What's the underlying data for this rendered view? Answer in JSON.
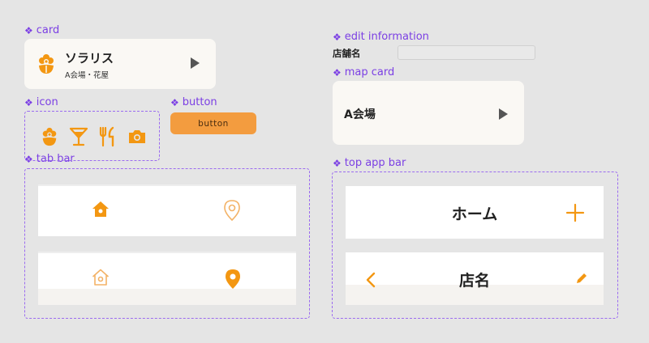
{
  "sections": {
    "card": "card",
    "edit_information": "edit information",
    "map_card": "map card",
    "icon": "icon",
    "button": "button",
    "tab_bar": "tab bar",
    "top_app_bar": "top app bar"
  },
  "card": {
    "title": "ソラリス",
    "subtitle": "A会場・花屋",
    "icon": "flower-icon",
    "action_icon": "play-icon"
  },
  "edit_information": {
    "label": "店舗名",
    "value": ""
  },
  "map_card": {
    "title": "A会場",
    "action_icon": "play-icon"
  },
  "icons": [
    "flower-icon",
    "cocktail-icon",
    "fork-knife-icon",
    "camera-icon"
  ],
  "button": {
    "label": "button"
  },
  "tab_bars": [
    {
      "selected": "home",
      "items": [
        "home-icon",
        "location-pin-icon"
      ]
    },
    {
      "selected": "map",
      "items": [
        "home-icon",
        "location-pin-icon"
      ]
    }
  ],
  "top_app_bars": [
    {
      "title": "ホーム",
      "right_icon": "plus-icon"
    },
    {
      "title": "店名",
      "left_icon": "back-chevron-icon",
      "right_icon": "pencil-icon"
    }
  ],
  "colors": {
    "accent": "#f39712",
    "label_purple": "#7b3fe4",
    "card_bg": "#faf8f4",
    "button_bg": "#f39c3f",
    "page_bg": "#e5e5e5"
  }
}
